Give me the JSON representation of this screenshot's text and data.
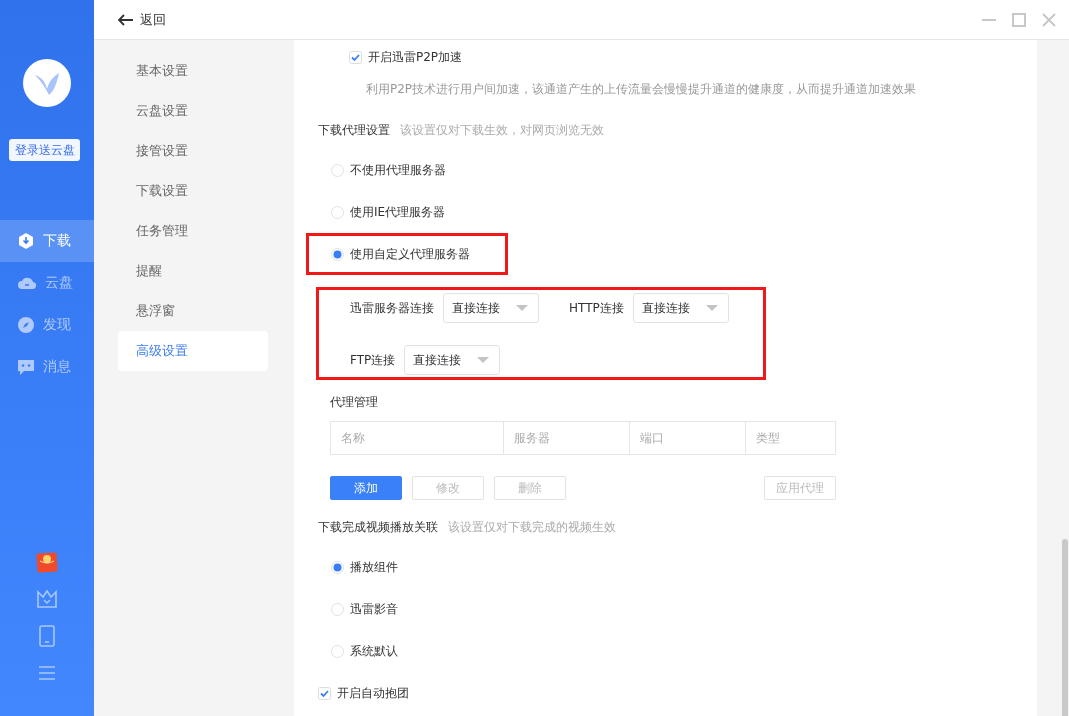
{
  "title_bar": {
    "back_label": "返回"
  },
  "sidebar": {
    "login_button": "登录送云盘",
    "items": [
      {
        "label": "下载",
        "selected": true
      },
      {
        "label": "云盘",
        "selected": false
      },
      {
        "label": "发现",
        "selected": false
      },
      {
        "label": "消息",
        "selected": false
      }
    ]
  },
  "settings_nav": {
    "items": [
      {
        "label": "基本设置",
        "selected": false
      },
      {
        "label": "云盘设置",
        "selected": false
      },
      {
        "label": "接管设置",
        "selected": false
      },
      {
        "label": "下载设置",
        "selected": false
      },
      {
        "label": "任务管理",
        "selected": false
      },
      {
        "label": "提醒",
        "selected": false
      },
      {
        "label": "悬浮窗",
        "selected": false
      },
      {
        "label": "高级设置",
        "selected": true
      }
    ]
  },
  "p2p": {
    "label": "开启迅雷P2P加速",
    "checked": true,
    "description": "利用P2P技术进行用户间加速，该通道产生的上传流量会慢慢提升通道的健康度，从而提升通道加速效果"
  },
  "proxy": {
    "title": "下载代理设置",
    "hint": "该设置仅对下载生效，对网页浏览无效",
    "options": [
      {
        "label": "不使用代理服务器",
        "selected": false,
        "highlighted": false
      },
      {
        "label": "使用IE代理服务器",
        "selected": false,
        "highlighted": false
      },
      {
        "label": "使用自定义代理服务器",
        "selected": true,
        "highlighted": true
      }
    ],
    "connections": {
      "highlighted": true,
      "fields": [
        {
          "label": "迅雷服务器连接",
          "value": "直接连接"
        },
        {
          "label": "HTTP连接",
          "value": "直接连接"
        },
        {
          "label": "FTP连接",
          "value": "直接连接"
        }
      ]
    },
    "management": {
      "title": "代理管理",
      "columns": [
        "名称",
        "服务器",
        "端口",
        "类型"
      ],
      "buttons": [
        {
          "label": "添加",
          "disabled": false
        },
        {
          "label": "修改",
          "disabled": true
        },
        {
          "label": "删除",
          "disabled": true
        },
        {
          "label": "应用代理",
          "disabled": true
        }
      ]
    }
  },
  "video": {
    "title": "下载完成视频播放关联",
    "hint": "该设置仅对下载完成的视频生效",
    "options": [
      {
        "label": "播放组件",
        "selected": true
      },
      {
        "label": "迅雷影音",
        "selected": false
      },
      {
        "label": "系统默认",
        "selected": false
      }
    ]
  },
  "auto_group": {
    "label": "开启自动抱团",
    "checked": true
  }
}
